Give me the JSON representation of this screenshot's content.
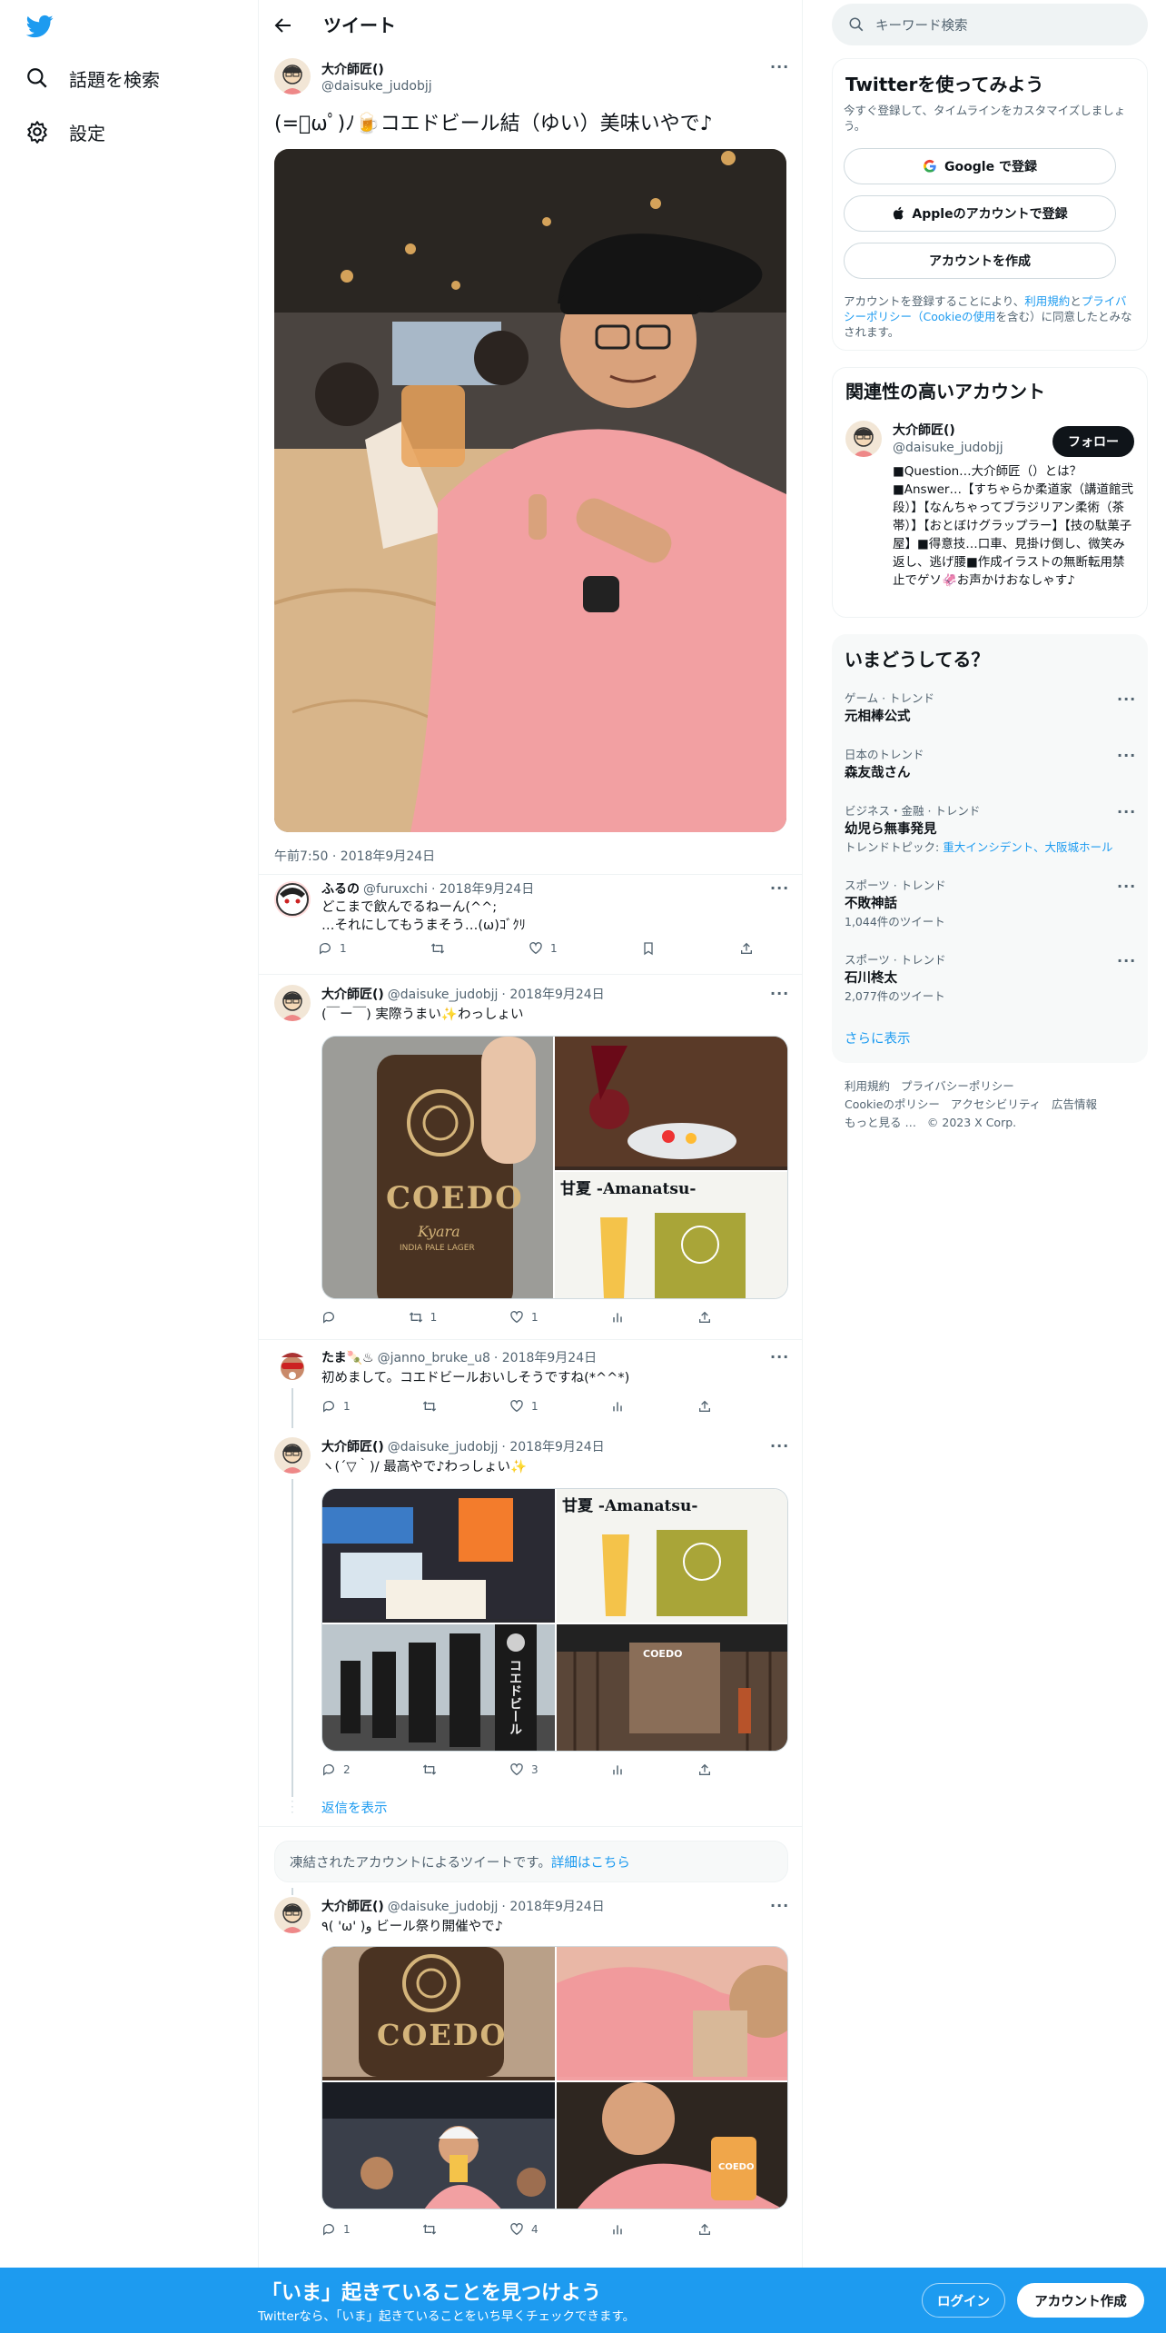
{
  "nav": {
    "explore_label": "話題を検索",
    "settings_label": "設定"
  },
  "header": {
    "title": "ツイート"
  },
  "main_tweet": {
    "name": "大介師匠()",
    "handle": "@daisuke_judobjj",
    "text": "(=ﾟωﾟ)ﾉ🍺コエドビール結（ゆい）美味いやで♪",
    "timestamp": "午前7:50 · 2018年9月24日"
  },
  "replies": [
    {
      "name": "ふるの",
      "handle": "@furuxchi",
      "date": "· 2018年9月24日",
      "line1": "どこまで飲んでるねーん(^^;",
      "line2": "…それにしてもうまそう…(ω)ｺﾞｸﾘ",
      "reply_count": "1",
      "like_count": "1"
    },
    {
      "name": "大介師匠()",
      "handle": "@daisuke_judobjj",
      "date": "· 2018年9月24日",
      "text": "(￣ー￣) 実際うまい✨わっしょい",
      "retweet_count": "1",
      "like_count": "1"
    },
    {
      "name": "たま🍡♨",
      "handle": "@janno_bruke_u8",
      "date": "· 2018年9月24日",
      "text": "初めまして。コエドビールおいしそうですね(*^^*)",
      "reply_count": "1",
      "like_count": "1"
    },
    {
      "name": "大介師匠()",
      "handle": "@daisuke_judobjj",
      "date": "· 2018年9月24日",
      "text": "ヽ(´▽｀)/ 最高やで♪わっしょい✨",
      "reply_count": "2",
      "like_count": "3"
    },
    {
      "name": "大介師匠()",
      "handle": "@daisuke_judobjj",
      "date": "· 2018年9月24日",
      "text": "٩( 'ω' )و ビール祭り開催やで♪",
      "reply_count": "1",
      "like_count": "4"
    }
  ],
  "show_replies": "返信を表示",
  "suspended": {
    "text": "凍結されたアカウントによるツイートです。",
    "link": "詳細はこちら"
  },
  "photo_labels": {
    "coedo": "COEDO",
    "kyara": "Kyara",
    "ipl": "INDIA PALE LAGER",
    "amanatsu": "甘夏 -Amanatsu-",
    "koedo_beer": "コエドビール"
  },
  "search": {
    "placeholder": "キーワード検索"
  },
  "signup": {
    "title": "Twitterを使ってみよう",
    "desc": "今すぐ登録して、タイムラインをカスタマイズしましょう。",
    "google": "Google で登録",
    "apple": "Appleのアカウントで登録",
    "create": "アカウントを作成",
    "legal_prefix": "アカウントを登録することにより、",
    "terms": "利用規約",
    "and": "と",
    "privacy": "プライバシーポリシー",
    "cookie": "（Cookieの使用",
    "legal_suffix": "を含む）に同意したとみなされます。"
  },
  "related": {
    "title": "関連性の高いアカウント",
    "name": "大介師匠()",
    "handle": "@daisuke_judobjj",
    "follow": "フォロー",
    "bio": "■Question…大介師匠（）とは？■Answer…【すちゃらか柔道家（講道館弐段）】【なんちゃってブラジリアン柔術（茶帯）】【おとぼけグラップラー】【技の駄菓子屋】■得意技…口車、見掛け倒し、微笑み返し、逃げ腰■作成イラストの無断転用禁止でゲソ🦑お声かけおなしゃす♪"
  },
  "trends": {
    "title": "いまどうしてる？",
    "items": [
      {
        "cat": "ゲーム · トレンド",
        "name": "元相棒公式",
        "sub": ""
      },
      {
        "cat": "日本のトレンド",
        "name": "森友哉さん",
        "sub": ""
      },
      {
        "cat": "ビジネス・金融 · トレンド",
        "name": "幼児ら無事発見",
        "sub": "トレンドトピック: ",
        "sub_link": "重大インシデント、大阪城ホール"
      },
      {
        "cat": "スポーツ · トレンド",
        "name": "不敗神話",
        "sub": "1,044件のツイート"
      },
      {
        "cat": "スポーツ · トレンド",
        "name": "石川柊太",
        "sub": "2,077件のツイート"
      }
    ],
    "more": "さらに表示"
  },
  "footer": {
    "terms": "利用規約",
    "privacy": "プライバシーポリシー",
    "cookie": "Cookieのポリシー",
    "access": "アクセシビリティ",
    "ads": "広告情報",
    "more": "もっと見る …",
    "copy": "© 2023 X Corp."
  },
  "bottom": {
    "title": "「いま」起きていることを見つけよう",
    "sub": "Twitterなら、「いま」起きていることをいち早くチェックできます。",
    "login": "ログイン",
    "signup": "アカウント作成"
  },
  "colors": {
    "accent": "#1d9bf0",
    "text": "#0f1419",
    "muted": "#536471"
  }
}
